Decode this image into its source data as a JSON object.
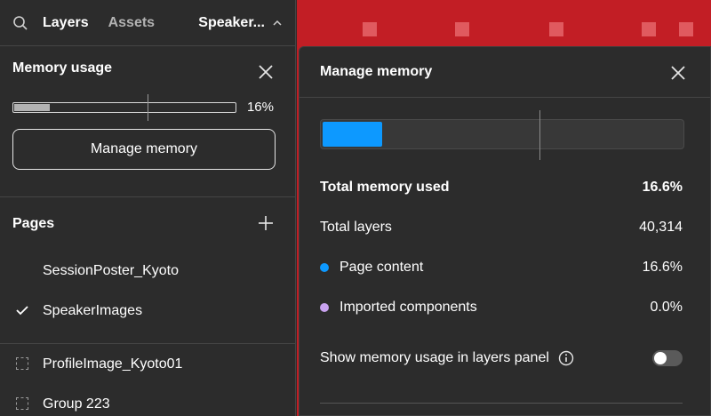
{
  "topbar": {
    "tabs": [
      {
        "label": "Layers",
        "active": true
      },
      {
        "label": "Assets",
        "active": false
      }
    ],
    "page_switcher_label": "Speaker..."
  },
  "memory_panel": {
    "title": "Memory usage",
    "percent_label": "16%",
    "usage_fraction": 0.16,
    "button_label": "Manage memory"
  },
  "pages": {
    "title": "Pages",
    "items": [
      {
        "label": "SessionPoster_Kyoto",
        "selected": false
      },
      {
        "label": "SpeakerImages",
        "selected": true
      }
    ]
  },
  "layers": [
    {
      "label": "ProfileImage_Kyoto01"
    },
    {
      "label": "Group 223"
    }
  ],
  "dialog": {
    "title": "Manage memory",
    "usage_fraction": 0.166,
    "rows": {
      "total_memory": {
        "label": "Total memory used",
        "value": "16.6%"
      },
      "total_layers": {
        "label": "Total layers",
        "value": "40,314"
      },
      "page_content": {
        "label": "Page content",
        "value": "16.6%",
        "color": "#0d99ff"
      },
      "imported_components": {
        "label": "Imported components",
        "value": "0.0%",
        "color": "#c9a3f0"
      }
    },
    "toggle": {
      "label": "Show memory usage in layers panel",
      "on": false
    }
  },
  "colors": {
    "canvas_bg": "#c21e25",
    "accent_blue": "#0d99ff"
  }
}
